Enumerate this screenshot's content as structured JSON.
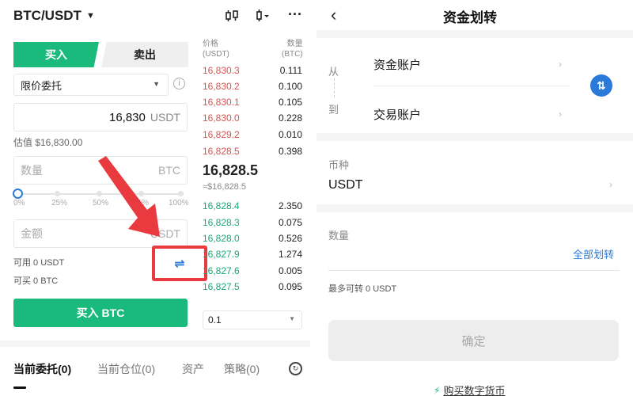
{
  "trade": {
    "pair": "BTC/USDT",
    "buy_tab": "买入",
    "sell_tab": "卖出",
    "order_type": "限价委托",
    "price_value": "16,830",
    "price_unit": "USDT",
    "estimate": "估值 $16,830.00",
    "qty_placeholder": "数量",
    "qty_unit": "BTC",
    "slider_value_pct": 0,
    "slider_marks": [
      "0%",
      "25%",
      "50%",
      "75%",
      "100%"
    ],
    "amount_placeholder": "金额",
    "amount_unit": "USDT",
    "available": "可用 0 USDT",
    "can_buy": "可买 0 BTC",
    "buy_button": "买入 BTC",
    "highlight_color": "#e83a3f"
  },
  "orderbook": {
    "price_header": "价格",
    "price_header_unit": "(USDT)",
    "qty_header": "数量",
    "qty_header_unit": "(BTC)",
    "asks": [
      {
        "price": "16,830.3",
        "qty": "0.111"
      },
      {
        "price": "16,830.2",
        "qty": "0.100"
      },
      {
        "price": "16,830.1",
        "qty": "0.105"
      },
      {
        "price": "16,830.0",
        "qty": "0.228"
      },
      {
        "price": "16,829.2",
        "qty": "0.010"
      },
      {
        "price": "16,828.5",
        "qty": "0.398"
      }
    ],
    "last_price": "16,828.5",
    "last_fiat": "≈$16,828.5",
    "bids": [
      {
        "price": "16,828.4",
        "qty": "2.350"
      },
      {
        "price": "16,828.3",
        "qty": "0.075"
      },
      {
        "price": "16,828.0",
        "qty": "0.526"
      },
      {
        "price": "16,827.9",
        "qty": "1.274"
      },
      {
        "price": "16,827.6",
        "qty": "0.005"
      },
      {
        "price": "16,827.5",
        "qty": "0.095"
      }
    ],
    "depth": "0.1",
    "ask_color": "#d9534f",
    "bid_color": "#19a974"
  },
  "bottom_tabs": [
    "当前委托(0)",
    "当前仓位(0)",
    "资产",
    "策略(0)"
  ],
  "transfer": {
    "title": "资金划转",
    "from_label": "从",
    "to_label": "到",
    "from_account": "资金账户",
    "to_account": "交易账户",
    "coin_label": "币种",
    "coin_value": "USDT",
    "qty_label": "数量",
    "transfer_all": "全部划转",
    "max_transferable": "最多可转 0 USDT",
    "confirm": "确定",
    "buy_crypto": "购买数字货币",
    "accent_color": "#2b7ad9"
  }
}
